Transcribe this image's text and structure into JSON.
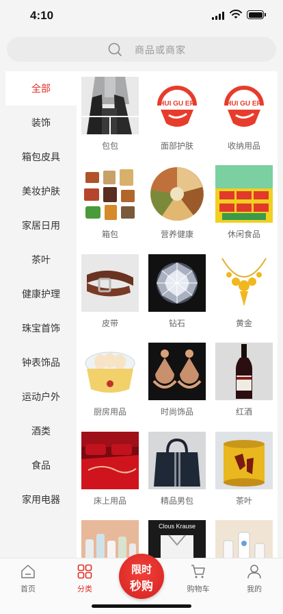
{
  "status_bar": {
    "time": "4:10"
  },
  "search": {
    "placeholder": "商品或商家"
  },
  "categories": [
    {
      "label": "全部",
      "active": true
    },
    {
      "label": "装饰"
    },
    {
      "label": "箱包皮具"
    },
    {
      "label": "美妆护肤"
    },
    {
      "label": "家居日用"
    },
    {
      "label": "茶叶"
    },
    {
      "label": "健康护理"
    },
    {
      "label": "珠宝首饰"
    },
    {
      "label": "钟表饰品"
    },
    {
      "label": "运动户外"
    },
    {
      "label": "酒类"
    },
    {
      "label": "食品"
    },
    {
      "label": "家用电器"
    }
  ],
  "products": [
    {
      "label": "包包",
      "image": "backpack-photo"
    },
    {
      "label": "面部护肤",
      "image": "huiguer-logo"
    },
    {
      "label": "收纳用品",
      "image": "huiguer-logo"
    },
    {
      "label": "箱包",
      "image": "luggage-collage"
    },
    {
      "label": "营养健康",
      "image": "nuts-platter"
    },
    {
      "label": "休闲食品",
      "image": "snack-boxes"
    },
    {
      "label": "皮带",
      "image": "leather-belt"
    },
    {
      "label": "钻石",
      "image": "diamond"
    },
    {
      "label": "黄金",
      "image": "gold-necklace"
    },
    {
      "label": "厨房用品",
      "image": "egg-cooker"
    },
    {
      "label": "时尚饰品",
      "image": "earrings"
    },
    {
      "label": "红酒",
      "image": "wine-bottle"
    },
    {
      "label": "床上用品",
      "image": "red-bedding"
    },
    {
      "label": "精品男包",
      "image": "mens-handbag"
    },
    {
      "label": "茶叶",
      "image": "tea-tin"
    },
    {
      "label": "",
      "image": "cosmetics-bottles"
    },
    {
      "label": "",
      "image": "clous-krause-shirt"
    },
    {
      "label": "",
      "image": "medical-devices"
    }
  ],
  "logo_text": "HUI GU ER",
  "banner_text": {
    "clous_krause": "Clous Krause"
  },
  "tabbar": {
    "items": [
      {
        "label": "首页",
        "icon": "home-icon"
      },
      {
        "label": "分类",
        "icon": "category-grid-icon",
        "active": true
      },
      {
        "label": "购物车",
        "icon": "cart-icon"
      },
      {
        "label": "我的",
        "icon": "person-icon"
      }
    ],
    "flash_sale": {
      "line1": "限时",
      "line2": "秒购"
    }
  },
  "colors": {
    "accent": "#e02e24",
    "background": "#f4f4f4"
  }
}
